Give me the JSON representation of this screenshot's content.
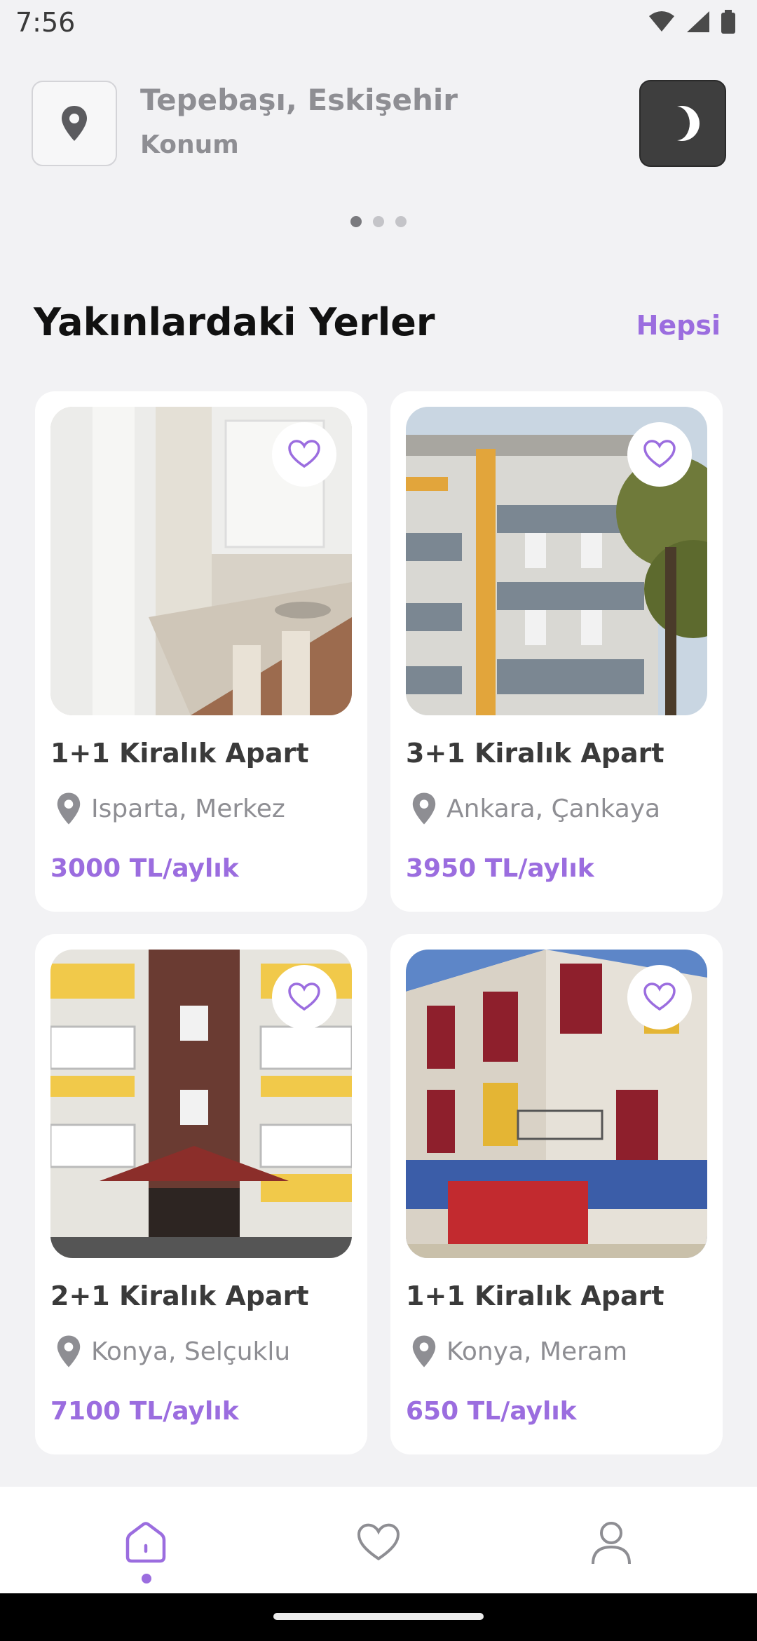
{
  "status": {
    "time": "7:56"
  },
  "header": {
    "location_city": "Tepebaşı, Eskişehir",
    "location_label": "Konum"
  },
  "section": {
    "title": "Yakınlardaki Yerler",
    "see_all": "Hepsi"
  },
  "listings": [
    {
      "title": "1+1 Kiralık Apart",
      "location": "Isparta, Merkez",
      "price": "3000 TL/aylık"
    },
    {
      "title": "3+1 Kiralık Apart",
      "location": "Ankara, Çankaya",
      "price": "3950 TL/aylık"
    },
    {
      "title": "2+1 Kiralık Apart",
      "location": "Konya, Selçuklu",
      "price": "7100 TL/aylık"
    },
    {
      "title": "1+1 Kiralık Apart",
      "location": "Konya, Meram",
      "price": "650 TL/aylık"
    }
  ],
  "nav": {
    "active": "home",
    "items": [
      "home-icon",
      "heart-icon",
      "profile-icon"
    ]
  },
  "colors": {
    "accent": "#9b6ddf",
    "background": "#f2f2f4",
    "card": "#ffffff",
    "muted_text": "#8e8e93"
  }
}
